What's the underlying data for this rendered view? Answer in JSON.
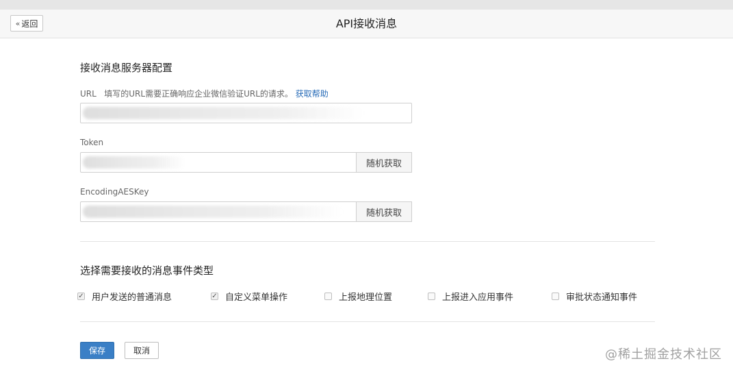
{
  "header": {
    "back_label": "返回",
    "back_icon": "double-chevron-left-icon",
    "title": "API接收消息"
  },
  "server_config": {
    "section_title": "接收消息服务器配置",
    "url": {
      "label": "URL",
      "hint": "填写的URL需要正确响应企业微信验证URL的请求。",
      "help_link": "获取帮助"
    },
    "token": {
      "label": "Token",
      "random_button": "随机获取"
    },
    "aes_key": {
      "label": "EncodingAESKey",
      "random_button": "随机获取"
    }
  },
  "events": {
    "section_title": "选择需要接收的消息事件类型",
    "items": [
      {
        "label": "用户发送的普通消息",
        "checked": true
      },
      {
        "label": "自定义菜单操作",
        "checked": true
      },
      {
        "label": "上报地理位置",
        "checked": false
      },
      {
        "label": "上报进入应用事件",
        "checked": false
      },
      {
        "label": "审批状态通知事件",
        "checked": false
      }
    ]
  },
  "actions": {
    "save_label": "保存",
    "cancel_label": "取消"
  },
  "watermark": "@稀土掘金技术社区",
  "colors": {
    "primary": "#3a7fc6",
    "link": "#2a6db8",
    "header_bg": "#f7f7f7"
  }
}
